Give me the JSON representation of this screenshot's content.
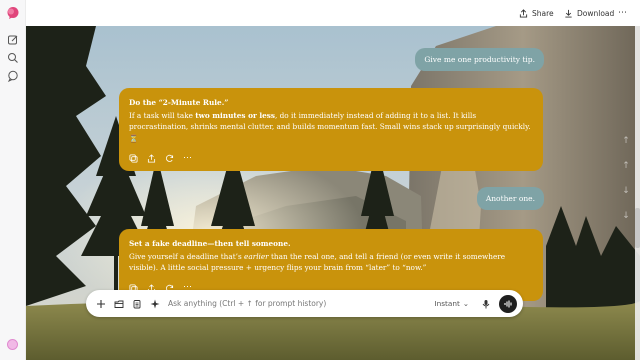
{
  "topbar": {
    "share_label": "Share",
    "download_label": "Download",
    "more_label": "⋯"
  },
  "messages": {
    "user1": "Give me one productivity tip.",
    "ai1_title": "Do the “2-Minute Rule.”",
    "ai1_part1": "If a task will take ",
    "ai1_bold": "two minutes or less",
    "ai1_part2": ", do it immediately instead of adding it to a list. It kills procrastination, shrinks mental clutter, and builds momentum fast. Small wins stack up surprisingly quickly. ⏳",
    "user2": "Another one.",
    "ai2_title": "Set a fake deadline—then tell someone.",
    "ai2_part1": "Give yourself a deadline that’s ",
    "ai2_italic": "earlier",
    "ai2_part2": " than the real one, and tell a friend (or even write it somewhere visible). A little social pressure + urgency flips your brain from “later” to “now.”"
  },
  "composer": {
    "placeholder": "Ask anything (Ctrl + ↑ for prompt history)",
    "mode": "Instant",
    "mode_caret": "⌄"
  },
  "icons": {
    "logo": "app-logo-icon",
    "new_chat": "new-chat-icon",
    "search": "search-icon",
    "chats": "chat-bubble-icon",
    "share": "share-icon",
    "download": "download-icon"
  },
  "colors": {
    "user_bubble": "#7fa3a6",
    "ai_card": "#c9930c",
    "voice_button": "#1f1f1f"
  }
}
